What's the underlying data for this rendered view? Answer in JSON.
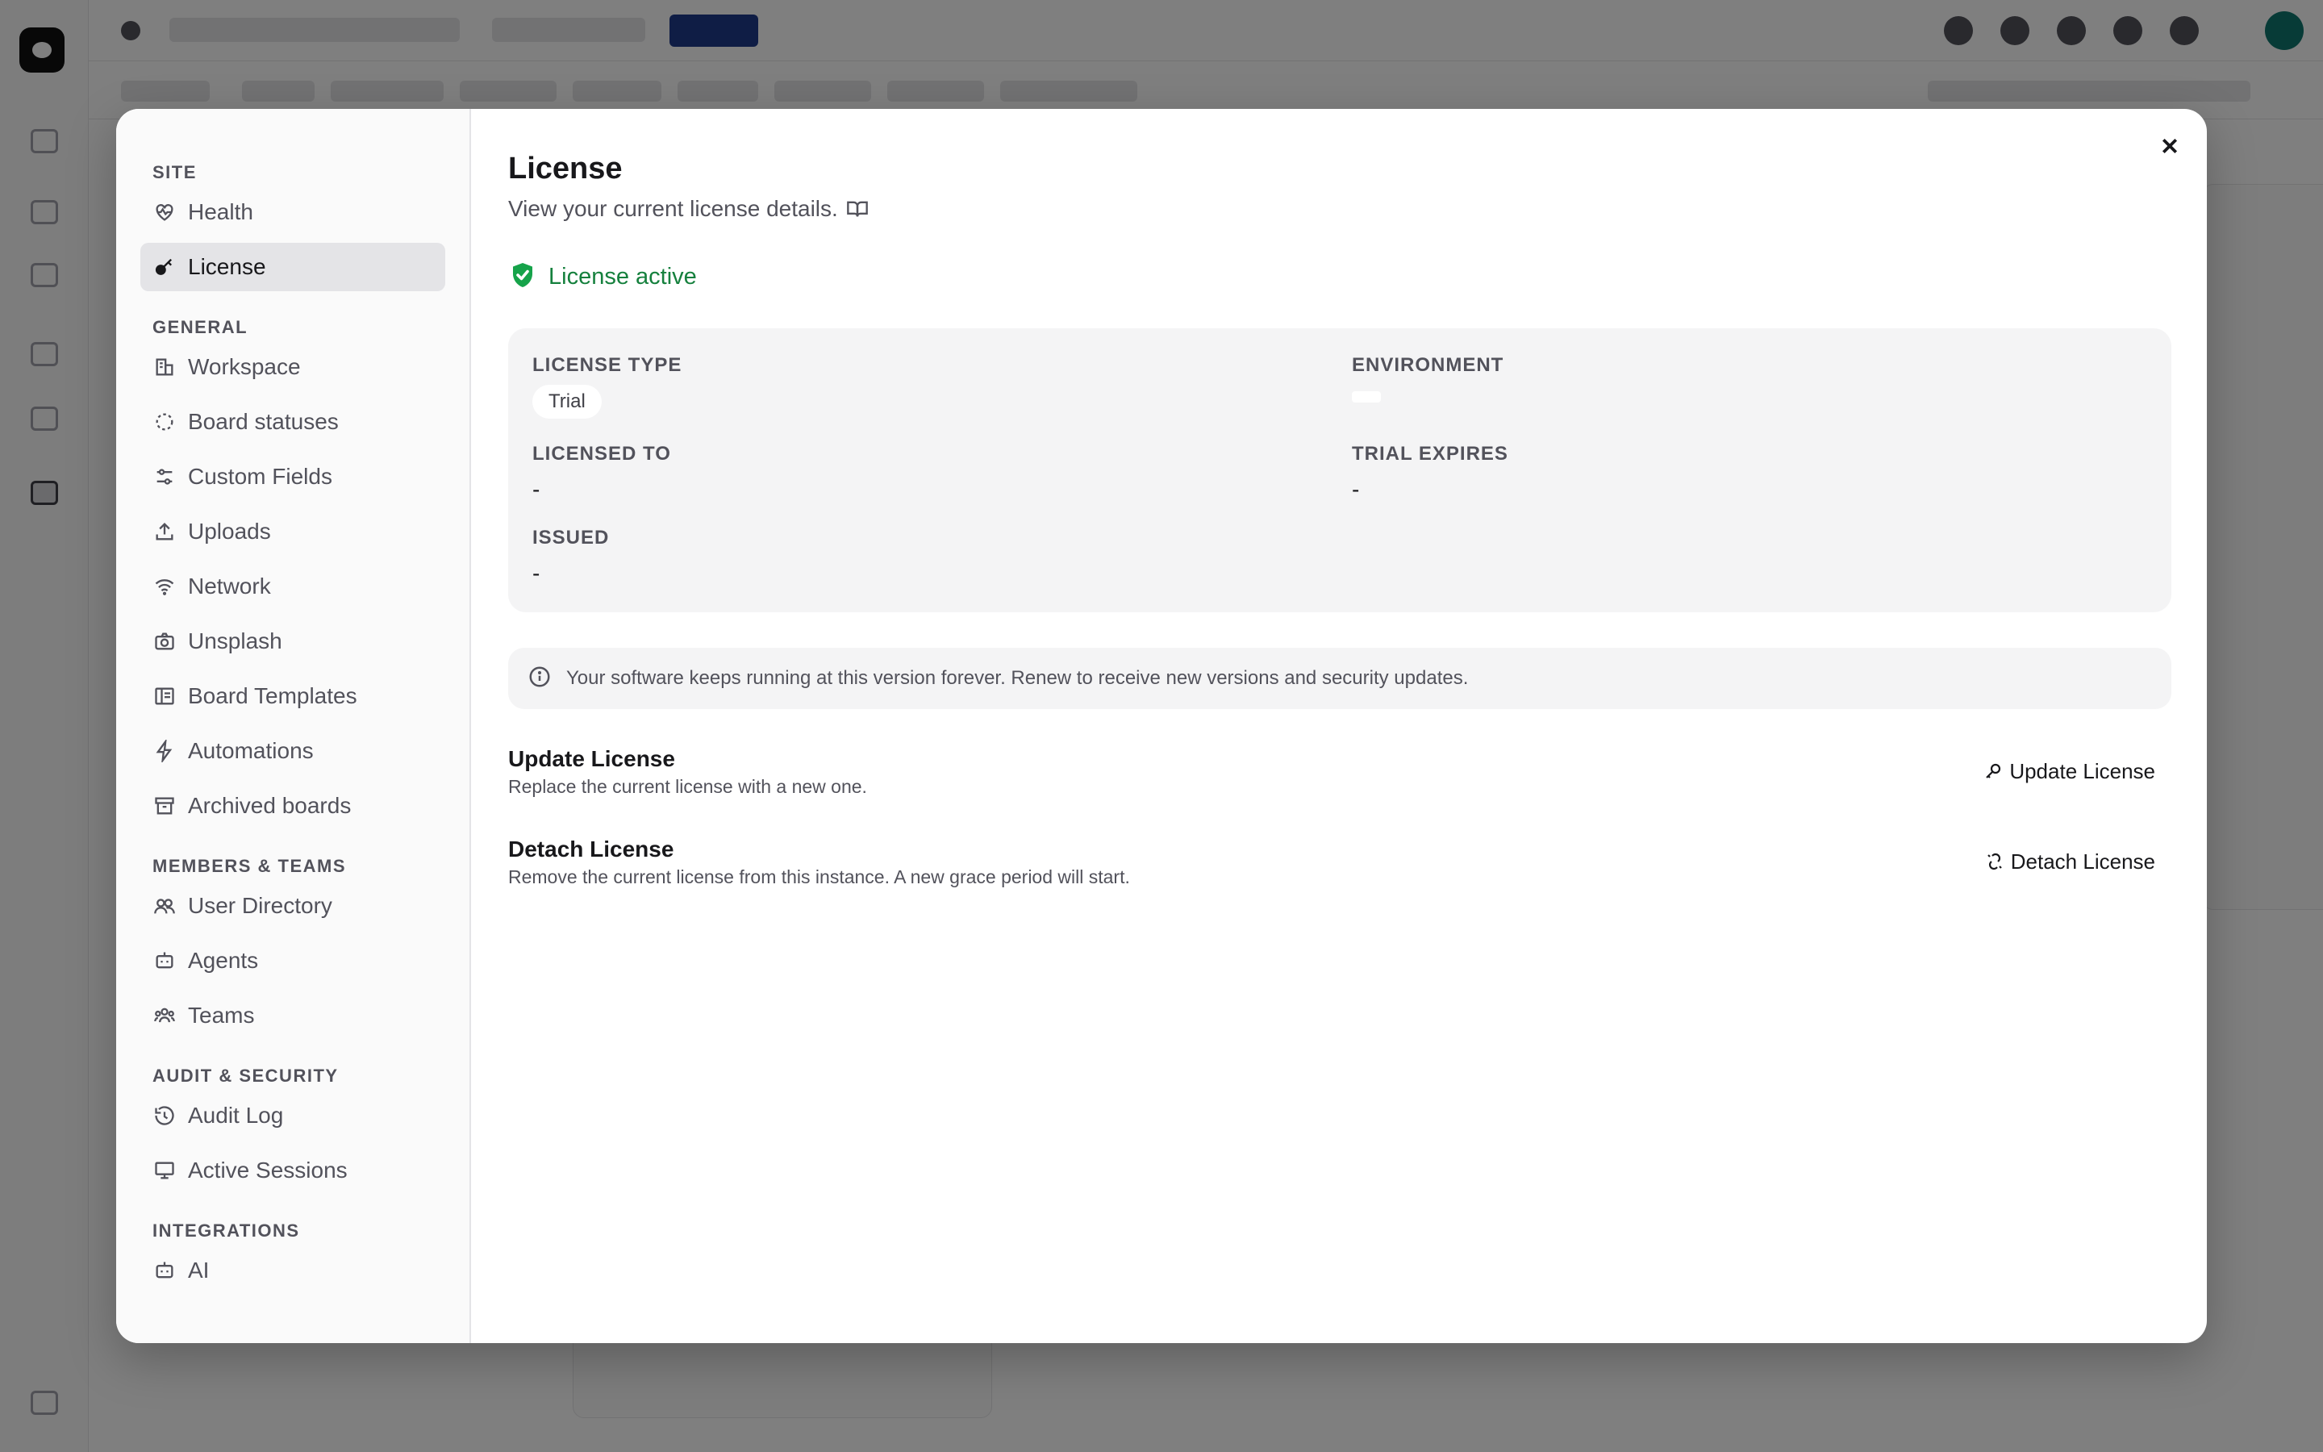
{
  "modal": {
    "sections": [
      {
        "title": "SITE",
        "items": [
          {
            "label": "Health",
            "icon": "heart-pulse-icon"
          },
          {
            "label": "License",
            "icon": "key-icon",
            "active": true
          }
        ]
      },
      {
        "title": "GENERAL",
        "items": [
          {
            "label": "Workspace",
            "icon": "building-icon"
          },
          {
            "label": "Board statuses",
            "icon": "dashed-circle-icon"
          },
          {
            "label": "Custom Fields",
            "icon": "sliders-icon"
          },
          {
            "label": "Uploads",
            "icon": "upload-icon"
          },
          {
            "label": "Network",
            "icon": "wifi-icon"
          },
          {
            "label": "Unsplash",
            "icon": "camera-icon"
          },
          {
            "label": "Board Templates",
            "icon": "template-icon"
          },
          {
            "label": "Automations",
            "icon": "zap-icon"
          },
          {
            "label": "Archived boards",
            "icon": "archive-icon"
          }
        ]
      },
      {
        "title": "MEMBERS & TEAMS",
        "items": [
          {
            "label": "User Directory",
            "icon": "users-icon"
          },
          {
            "label": "Agents",
            "icon": "bot-icon"
          },
          {
            "label": "Teams",
            "icon": "team-icon"
          }
        ]
      },
      {
        "title": "AUDIT & SECURITY",
        "items": [
          {
            "label": "Audit Log",
            "icon": "history-icon"
          },
          {
            "label": "Active Sessions",
            "icon": "monitor-icon"
          }
        ]
      },
      {
        "title": "INTEGRATIONS",
        "items": [
          {
            "label": "AI",
            "icon": "bot-icon"
          }
        ]
      }
    ]
  },
  "license": {
    "title": "License",
    "subtitle": "View your current license details.",
    "status": "License active",
    "details": {
      "license_type_label": "LICENSE TYPE",
      "license_type_value": "Trial",
      "environment_label": "ENVIRONMENT",
      "licensed_to_label": "LICENSED TO",
      "licensed_to_value": "-",
      "trial_expires_label": "TRIAL EXPIRES",
      "trial_expires_value": "-",
      "issued_label": "ISSUED",
      "issued_value": "-"
    },
    "info": "Your software keeps running at this version forever. Renew to receive new versions and security updates.",
    "update": {
      "title": "Update License",
      "description": "Replace the current license with a new one.",
      "button": "Update License"
    },
    "detach": {
      "title": "Detach License",
      "description": "Remove the current license from this instance. A new grace period will start.",
      "button": "Detach License"
    }
  },
  "colors": {
    "accent_green": "#15803d",
    "shield_green": "#16a34a",
    "overlay": "rgba(0,0,0,0.5)"
  }
}
